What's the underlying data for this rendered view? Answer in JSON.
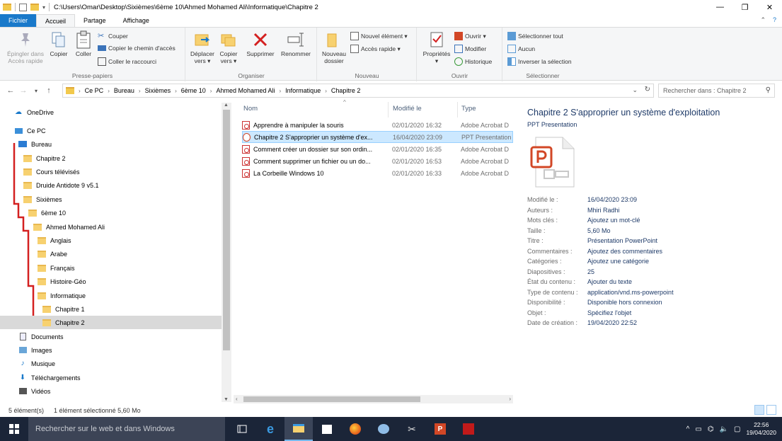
{
  "window": {
    "title": "C:\\Users\\Omar\\Desktop\\Sixièmes\\6ème 10\\Ahmed Mohamed Ali\\Informatique\\Chapitre 2",
    "minimize": "—",
    "maximize": "❐",
    "close": "✕"
  },
  "tabs": [
    {
      "label": "Fichier"
    },
    {
      "label": "Accueil"
    },
    {
      "label": "Partage"
    },
    {
      "label": "Affichage"
    }
  ],
  "ribbon": {
    "presse_papiers": {
      "label": "Presse-papiers",
      "epingler": "Épingler dans\nAccès rapide",
      "copier": "Copier",
      "coller": "Coller",
      "couper": "Couper",
      "copier_chemin": "Copier le chemin d'accès",
      "coller_raccourci": "Coller le raccourci"
    },
    "organiser": {
      "label": "Organiser",
      "deplacer": "Déplacer\nvers ▾",
      "copier_vers": "Copier\nvers ▾",
      "supprimer": "Supprimer",
      "renommer": "Renommer"
    },
    "nouveau": {
      "label": "Nouveau",
      "nouveau_dossier": "Nouveau\ndossier",
      "nouvel_element": "Nouvel élément ▾",
      "acces_rapide": "Accès rapide ▾"
    },
    "ouvrir": {
      "label": "Ouvrir",
      "proprietes": "Propriétés\n▾",
      "ouvrir": "Ouvrir ▾",
      "modifier": "Modifier",
      "historique": "Historique"
    },
    "selectionner": {
      "label": "Sélectionner",
      "tout": "Sélectionner tout",
      "aucun": "Aucun",
      "inverser": "Inverser la sélection"
    }
  },
  "address": {
    "crumbs": [
      "Ce PC",
      "Bureau",
      "Sixièmes",
      "6ème 10",
      "Ahmed Mohamed Ali",
      "Informatique",
      "Chapitre 2"
    ],
    "search_placeholder": "Rechercher dans : Chapitre 2"
  },
  "nav": {
    "items": [
      {
        "label": "OneDrive",
        "icon": "cloud-icon"
      },
      {
        "label": "Ce PC",
        "icon": "computer-icon"
      },
      {
        "label": "Bureau",
        "icon": "desktop-icon"
      },
      {
        "label": "Chapitre 2",
        "icon": "folder-icon"
      },
      {
        "label": "Cours télévisés",
        "icon": "folder-icon"
      },
      {
        "label": "Druide Antidote 9 v5.1",
        "icon": "folder-icon"
      },
      {
        "label": "Sixièmes",
        "icon": "folder-icon"
      },
      {
        "label": "6ème 10",
        "icon": "folder-icon"
      },
      {
        "label": "Ahmed Mohamed Ali",
        "icon": "folder-icon"
      },
      {
        "label": "Anglais",
        "icon": "folder-icon"
      },
      {
        "label": "Arabe",
        "icon": "folder-icon"
      },
      {
        "label": "Français",
        "icon": "folder-icon"
      },
      {
        "label": "Histoire-Géo",
        "icon": "folder-icon"
      },
      {
        "label": "Informatique",
        "icon": "folder-icon"
      },
      {
        "label": "Chapitre 1",
        "icon": "folder-icon"
      },
      {
        "label": "Chapitre 2",
        "icon": "folder-icon"
      },
      {
        "label": "Documents",
        "icon": "documents-icon"
      },
      {
        "label": "Images",
        "icon": "pictures-icon"
      },
      {
        "label": "Musique",
        "icon": "music-icon"
      },
      {
        "label": "Téléchargements",
        "icon": "download-icon"
      },
      {
        "label": "Vidéos",
        "icon": "video-icon"
      }
    ]
  },
  "files": {
    "columns": {
      "name": "Nom",
      "modified": "Modifié le",
      "type": "Type"
    },
    "rows": [
      {
        "name": "Apprendre à manipuler la souris",
        "modified": "02/01/2020 16:32",
        "type": "Adobe Acrobat D",
        "icon": "pdf-icon"
      },
      {
        "name": "Chapitre  2 S'approprier un système d'ex...",
        "modified": "16/04/2020 23:09",
        "type": "PPT Presentation",
        "icon": "ppt-icon"
      },
      {
        "name": "Comment créer un dossier sur son ordin...",
        "modified": "02/01/2020 16:35",
        "type": "Adobe Acrobat D",
        "icon": "pdf-icon"
      },
      {
        "name": "Comment supprimer un fichier ou un do...",
        "modified": "02/01/2020 16:53",
        "type": "Adobe Acrobat D",
        "icon": "pdf-icon"
      },
      {
        "name": "La Corbeille Windows 10",
        "modified": "02/01/2020 16:33",
        "type": "Adobe Acrobat D",
        "icon": "pdf-icon"
      }
    ]
  },
  "preview": {
    "title": "Chapitre  2 S'approprier un système d'exploitation",
    "type": "PPT Presentation",
    "props": [
      {
        "k": "Modifié le :",
        "v": "16/04/2020 23:09"
      },
      {
        "k": "Auteurs :",
        "v": "Mhiri Radhi"
      },
      {
        "k": "Mots clés :",
        "v": "Ajoutez un mot-clé"
      },
      {
        "k": "Taille :",
        "v": "5,60 Mo"
      },
      {
        "k": "Titre :",
        "v": "Présentation PowerPoint"
      },
      {
        "k": "Commentaires :",
        "v": "Ajoutez des commentaires"
      },
      {
        "k": "Catégories :",
        "v": "Ajoutez une catégorie"
      },
      {
        "k": "Diapositives :",
        "v": "25"
      },
      {
        "k": "État du contenu :",
        "v": "Ajouter du texte"
      },
      {
        "k": "Type de contenu :",
        "v": "application/vnd.ms-powerpoint"
      },
      {
        "k": "Disponibilité :",
        "v": "Disponible hors connexion"
      },
      {
        "k": "Objet :",
        "v": "Spécifiez l'objet"
      },
      {
        "k": "Date de création :",
        "v": "19/04/2020 22:52"
      }
    ]
  },
  "status": {
    "count": "5 élément(s)",
    "selection": "1 élément sélectionné  5,60 Mo"
  },
  "taskbar": {
    "search_placeholder": "Rechercher sur le web et dans Windows",
    "time": "22:56",
    "date": "19/04/2020"
  },
  "colors": {
    "accent": "#1979ca",
    "annotation": "#d42020"
  }
}
